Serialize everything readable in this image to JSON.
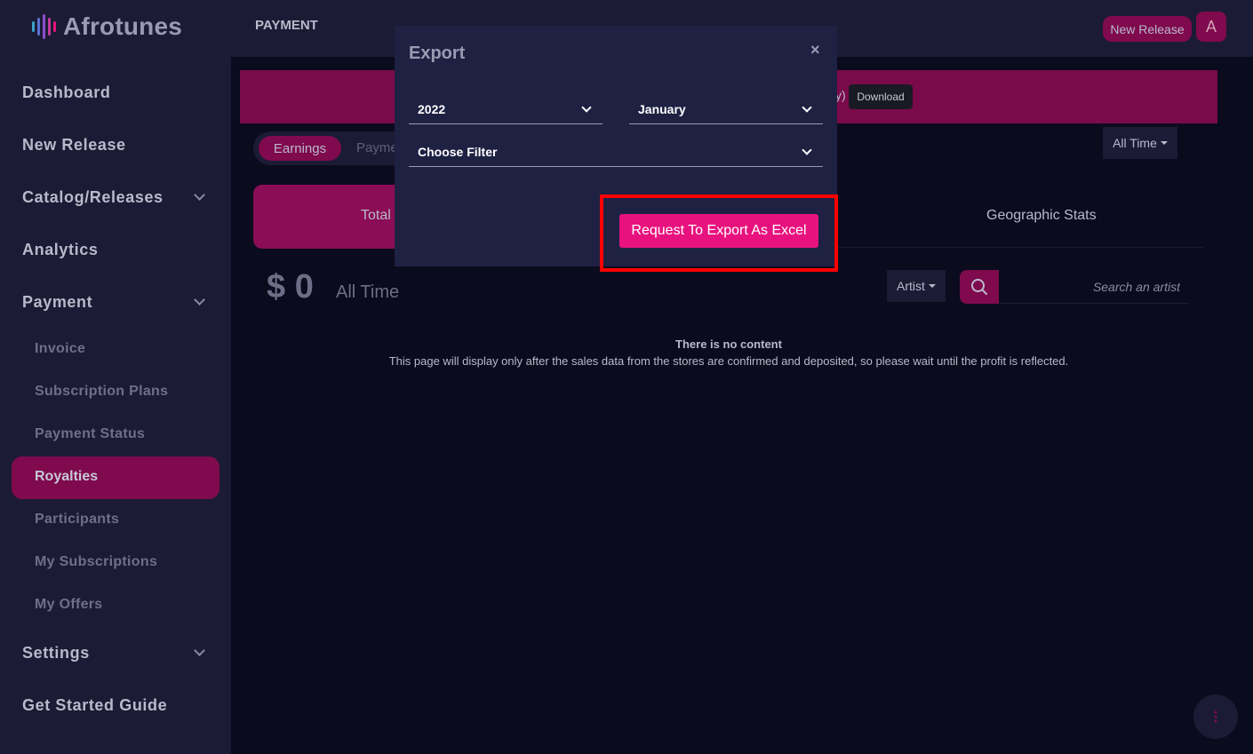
{
  "app": {
    "logo_text": "Afrotunes"
  },
  "sidebar": {
    "items": [
      {
        "label": "Dashboard"
      },
      {
        "label": "New Release"
      },
      {
        "label": "Catalog/Releases"
      },
      {
        "label": "Analytics"
      },
      {
        "label": "Payment"
      },
      {
        "label": "Settings"
      },
      {
        "label": "Get Started Guide"
      }
    ],
    "payment_sub": [
      {
        "label": "Invoice"
      },
      {
        "label": "Subscription Plans"
      },
      {
        "label": "Payment Status"
      },
      {
        "label": "Royalties"
      },
      {
        "label": "Participants"
      },
      {
        "label": "My Subscriptions"
      },
      {
        "label": "My Offers"
      }
    ]
  },
  "topbar": {
    "title": "PAYMENT",
    "new_release_label": "New Release",
    "avatar_initial": "A"
  },
  "banner": {
    "tail_text": "y)",
    "download_label": "Download"
  },
  "tabs": {
    "earnings": "Earnings",
    "payments": "Payme"
  },
  "period_dropdown": {
    "value": "All Time"
  },
  "stats": {
    "total_label": "Total",
    "geo_label": "Geographic Stats"
  },
  "summary": {
    "amount": "$ 0",
    "period": "All Time"
  },
  "filters": {
    "artist_label": "Artist",
    "search_placeholder": "Search an artist"
  },
  "empty_state": {
    "title": "There is no content",
    "description": "This page will display only after the sales data from the stores are confirmed and deposited, so please wait until the profit is reflected."
  },
  "modal": {
    "title": "Export",
    "close_symbol": "×",
    "year_value": "2022",
    "month_value": "January",
    "filter_value": "Choose Filter",
    "export_button_label": "Request To Export As Excel"
  },
  "colors": {
    "accent": "#e8127e",
    "active_bg": "#7f0a4d",
    "sidebar_bg": "#1b1b35",
    "page_bg": "#0b0b1e",
    "modal_bg": "#1f2143",
    "highlight": "#ff0000"
  }
}
